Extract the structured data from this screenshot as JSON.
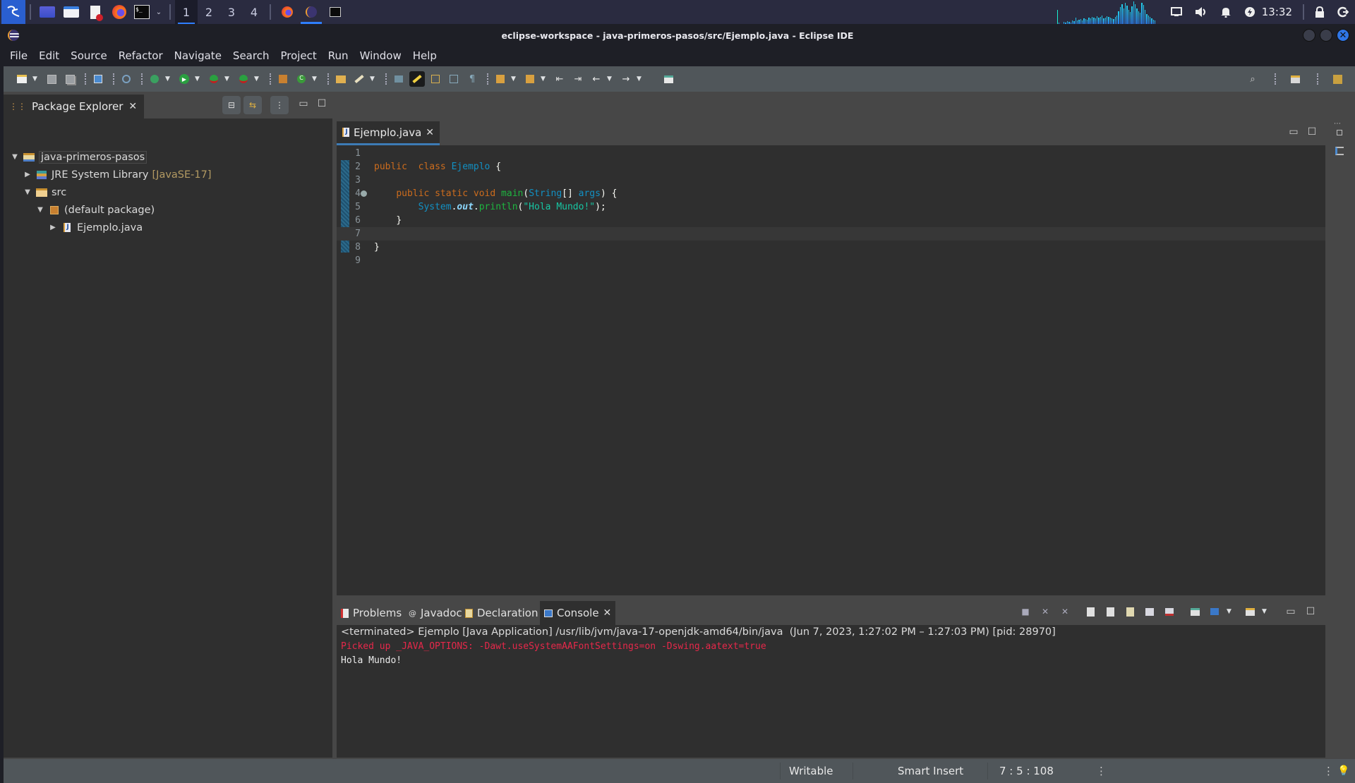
{
  "taskbar": {
    "launchers": [
      "kali-menu-icon",
      "desktop-icon",
      "file-manager-icon",
      "text-editor-icon",
      "firefox-icon",
      "terminal-icon"
    ],
    "workspaces": [
      "1",
      "2",
      "3",
      "4"
    ],
    "active_workspace": "1",
    "running_apps": [
      "firefox-icon",
      "eclipse-icon",
      "terminal-icon"
    ],
    "clock": "13:32",
    "accent_color": "#2f7fff"
  },
  "window": {
    "title": "eclipse-workspace - java-primeros-pasos/src/Ejemplo.java - Eclipse IDE"
  },
  "menubar": {
    "items": [
      "File",
      "Edit",
      "Source",
      "Refactor",
      "Navigate",
      "Search",
      "Project",
      "Run",
      "Window",
      "Help"
    ]
  },
  "package_explorer": {
    "title": "Package Explorer",
    "tree": [
      {
        "label": "java-primeros-pasos",
        "level": 0,
        "expanded": true,
        "icon": "project-icon"
      },
      {
        "label": "JRE System Library",
        "decoration": "[JavaSE-17]",
        "level": 1,
        "expanded": false,
        "icon": "library-icon"
      },
      {
        "label": "src",
        "level": 1,
        "expanded": true,
        "icon": "source-folder-icon"
      },
      {
        "label": "(default package)",
        "level": 2,
        "expanded": true,
        "icon": "package-icon"
      },
      {
        "label": "Ejemplo.java",
        "level": 3,
        "expanded": false,
        "icon": "java-file-icon"
      }
    ]
  },
  "editor": {
    "tab_label": "Ejemplo.java",
    "current_line": 7,
    "lines": [
      {
        "n": "1",
        "tokens": []
      },
      {
        "n": "2",
        "tokens": [
          [
            "kw",
            "public"
          ],
          [
            "",
            "  "
          ],
          [
            "kw",
            "class"
          ],
          [
            "",
            " "
          ],
          [
            "cls",
            "Ejemplo"
          ],
          [
            "",
            " "
          ],
          [
            "brace",
            "{"
          ]
        ]
      },
      {
        "n": "3",
        "tokens": []
      },
      {
        "n": "4",
        "tokens": [
          [
            "",
            "    "
          ],
          [
            "kw",
            "public"
          ],
          [
            "",
            " "
          ],
          [
            "kw",
            "static"
          ],
          [
            "",
            " "
          ],
          [
            "kw",
            "void"
          ],
          [
            "",
            " "
          ],
          [
            "meth",
            "main"
          ],
          [
            "brace",
            "("
          ],
          [
            "cls",
            "String"
          ],
          [
            "brace",
            "[] "
          ],
          [
            "cls",
            "args"
          ],
          [
            "brace",
            ") {"
          ]
        ]
      },
      {
        "n": "5",
        "tokens": [
          [
            "",
            "        "
          ],
          [
            "cls",
            "System"
          ],
          [
            "brace",
            "."
          ],
          [
            "fld",
            "out"
          ],
          [
            "brace",
            "."
          ],
          [
            "meth",
            "println"
          ],
          [
            "brace",
            "("
          ],
          [
            "str",
            "\"Hola Mundo!\""
          ],
          [
            "brace",
            ");"
          ]
        ]
      },
      {
        "n": "6",
        "tokens": [
          [
            "",
            "    "
          ],
          [
            "brace",
            "}"
          ]
        ]
      },
      {
        "n": "7",
        "tokens": []
      },
      {
        "n": "8",
        "tokens": [
          [
            "brace",
            "}"
          ]
        ]
      },
      {
        "n": "9",
        "tokens": []
      }
    ]
  },
  "bottom_panel": {
    "tabs": [
      "Problems",
      "Javadoc",
      "Declaration",
      "Console"
    ],
    "active_tab": "Console",
    "console": {
      "header": "<terminated> Ejemplo [Java Application] /usr/lib/jvm/java-17-openjdk-amd64/bin/java  (Jun 7, 2023, 1:27:02 PM – 1:27:03 PM) [pid: 28970]",
      "stderr": "Picked up _JAVA_OPTIONS: -Dawt.useSystemAAFontSettings=on -Dswing.aatext=true",
      "stdout": "Hola Mundo!",
      "stderr_color": "#e6284a"
    }
  },
  "statusbar": {
    "writable": "Writable",
    "insert_mode": "Smart Insert",
    "position": "7 : 5 : 108"
  }
}
